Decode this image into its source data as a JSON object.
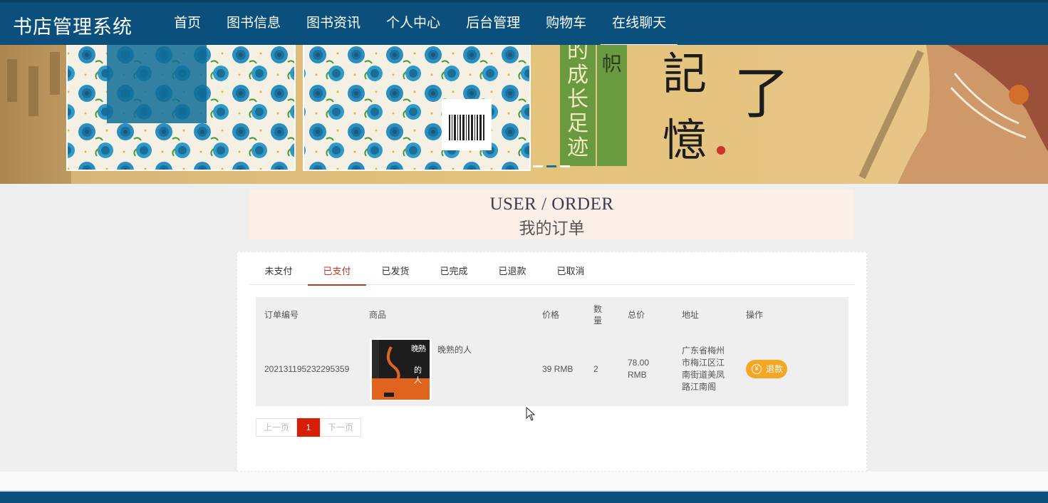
{
  "header": {
    "brand": "书店管理系统",
    "nav": [
      "首页",
      "图书信息",
      "图书资讯",
      "个人中心",
      "后台管理",
      "购物车",
      "在线聊天"
    ],
    "active_nav": "在线聊天"
  },
  "banner": {
    "slides": 3,
    "active_slide": 2,
    "text_vertical_green": "的成长足迹",
    "text_vertical_small": "帜",
    "text_calligraphy": "記憶了"
  },
  "page_title": {
    "en": "USER / ORDER",
    "cn": "我的订单"
  },
  "tabs": [
    "未支付",
    "已支付",
    "已发货",
    "已完成",
    "已退款",
    "已取消"
  ],
  "active_tab": "已支付",
  "table": {
    "headers": {
      "order_no": "订单编号",
      "product": "商品",
      "price": "价格",
      "qty_line1": "数",
      "qty_line2": "量",
      "total": "总价",
      "address": "地址",
      "action": "操作"
    },
    "rows": [
      {
        "order_no": "202131195232295359",
        "book_cover_title": "晚熟的人",
        "product_name": "晚熟的人",
        "price": "39 RMB",
        "qty": "2",
        "total_line1": "78.00",
        "total_line2": "RMB",
        "address_lines": [
          "广东省梅州",
          "市梅江区江",
          "南街道美凤",
          "路江南阁"
        ],
        "action_icon": "yen-icon",
        "action_label": "退款"
      }
    ]
  },
  "pagination": {
    "prev": "上一页",
    "current": "1",
    "next": "下一页"
  },
  "colors": {
    "nav_bg": "#0b4f7c",
    "active_tab": "#c0392b",
    "refund_btn": "#f5a623",
    "pager_current": "#d81e06",
    "title_bg": "#fcefe8"
  }
}
